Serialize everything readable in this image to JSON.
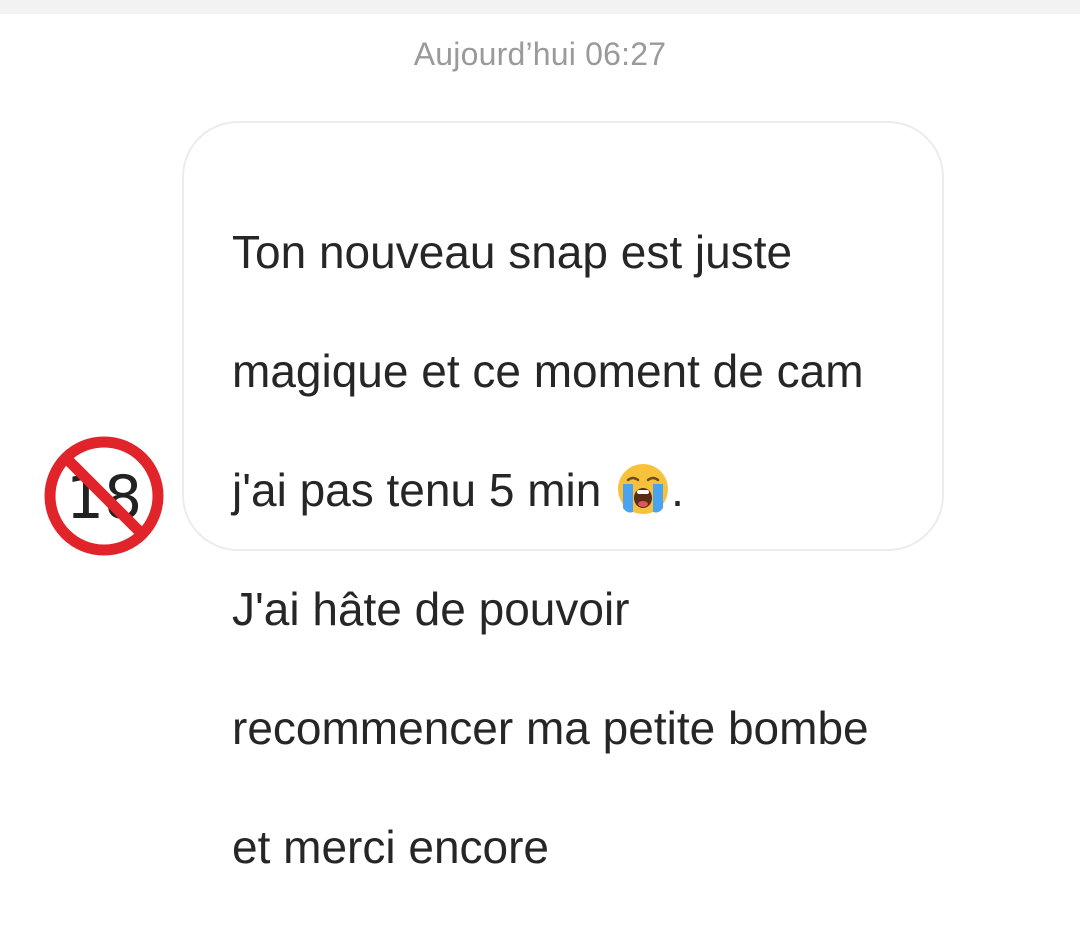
{
  "chat": {
    "timestamp": "Aujourd’hui 06:27"
  },
  "message": {
    "line1": "Ton nouveau snap est juste",
    "line2": "magique et ce moment de cam",
    "line3_before_emoji": "j'ai pas tenu 5 min ",
    "line3_after_emoji": ".",
    "line4": "J'ai hâte de pouvoir",
    "line5": "recommencer ma petite bombe",
    "line6": "et merci encore",
    "emoji": "loudly-crying-face-icon"
  },
  "avatar": {
    "icon": "no-one-under-eighteen-icon",
    "symbol": "18"
  },
  "colors": {
    "timestamp": "#9a9a9a",
    "text": "#262626",
    "bubble_border": "#ececec",
    "avatar_red": "#e0242a"
  }
}
